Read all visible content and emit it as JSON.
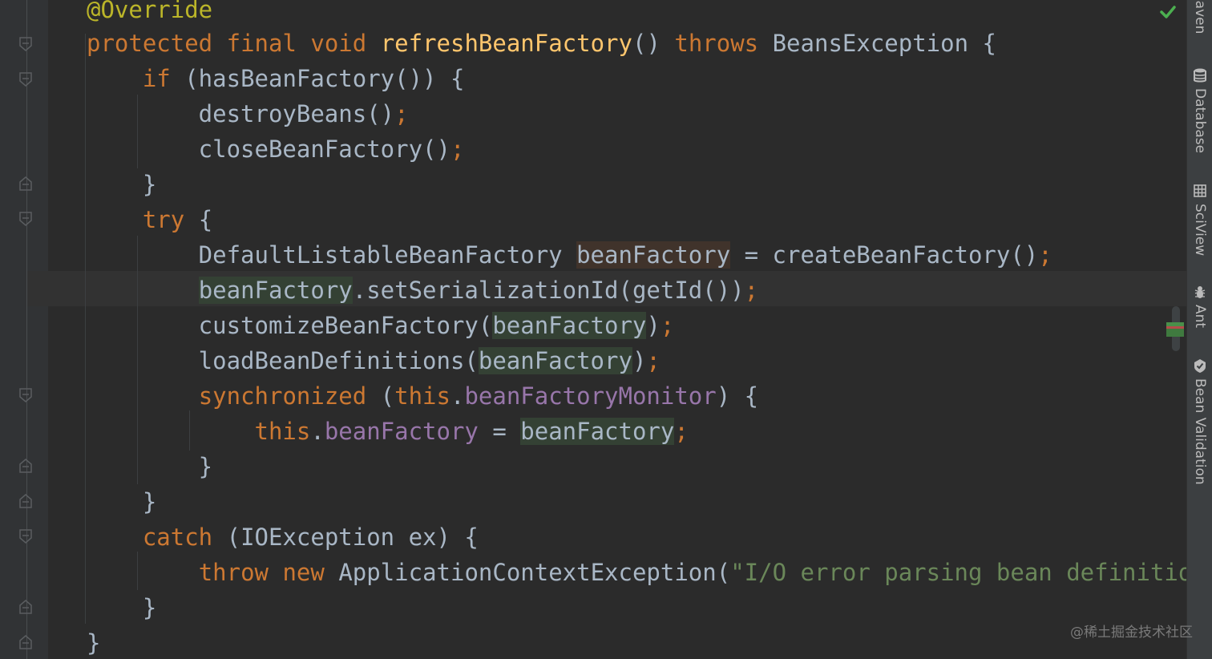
{
  "editor": {
    "lines": [
      {
        "tokens": [
          {
            "t": "@Override",
            "c": "ann"
          }
        ]
      },
      {
        "tokens": [
          {
            "t": "protected",
            "c": "kw"
          },
          {
            "t": " "
          },
          {
            "t": "final",
            "c": "kw"
          },
          {
            "t": " "
          },
          {
            "t": "void",
            "c": "kw"
          },
          {
            "t": " "
          },
          {
            "t": "refreshBeanFactory",
            "c": "fn"
          },
          {
            "t": "() "
          },
          {
            "t": "throws",
            "c": "kw"
          },
          {
            "t": " BeansException {"
          }
        ]
      },
      {
        "tokens": [
          {
            "t": "    "
          },
          {
            "t": "if",
            "c": "kw"
          },
          {
            "t": " (hasBeanFactory()) {"
          }
        ]
      },
      {
        "tokens": [
          {
            "t": "        destroyBeans()"
          },
          {
            "t": ";",
            "c": "semi"
          }
        ]
      },
      {
        "tokens": [
          {
            "t": "        closeBeanFactory()"
          },
          {
            "t": ";",
            "c": "semi"
          }
        ]
      },
      {
        "tokens": [
          {
            "t": "    }"
          }
        ]
      },
      {
        "tokens": [
          {
            "t": "    "
          },
          {
            "t": "try",
            "c": "kw"
          },
          {
            "t": " {"
          }
        ]
      },
      {
        "tokens": [
          {
            "t": "        DefaultListableBeanFactory "
          },
          {
            "t": "beanFactory",
            "c": "hl-red"
          },
          {
            "t": " = createBeanFactory()"
          },
          {
            "t": ";",
            "c": "semi"
          }
        ]
      },
      {
        "tokens": [
          {
            "t": "        "
          },
          {
            "t": "beanFactory",
            "c": "hl-green"
          },
          {
            "t": ".setSerializationId(getId())"
          },
          {
            "t": ";",
            "c": "semi"
          }
        ]
      },
      {
        "tokens": [
          {
            "t": "        customizeBeanFactory("
          },
          {
            "t": "beanFactory",
            "c": "hl-green"
          },
          {
            "t": ")"
          },
          {
            "t": ";",
            "c": "semi"
          }
        ]
      },
      {
        "tokens": [
          {
            "t": "        loadBeanDefinitions("
          },
          {
            "t": "beanFactory",
            "c": "hl-green"
          },
          {
            "t": ")"
          },
          {
            "t": ";",
            "c": "semi"
          }
        ]
      },
      {
        "tokens": [
          {
            "t": "        "
          },
          {
            "t": "synchronized",
            "c": "kw"
          },
          {
            "t": " ("
          },
          {
            "t": "this",
            "c": "kw"
          },
          {
            "t": "."
          },
          {
            "t": "beanFactoryMonitor",
            "c": "fld"
          },
          {
            "t": ") {"
          }
        ]
      },
      {
        "tokens": [
          {
            "t": "            "
          },
          {
            "t": "this",
            "c": "kw"
          },
          {
            "t": "."
          },
          {
            "t": "beanFactory",
            "c": "fld"
          },
          {
            "t": " = "
          },
          {
            "t": "beanFactory",
            "c": "hl-green"
          },
          {
            "t": ";",
            "c": "semi"
          }
        ]
      },
      {
        "tokens": [
          {
            "t": "        }"
          }
        ]
      },
      {
        "tokens": [
          {
            "t": "    }"
          }
        ]
      },
      {
        "tokens": [
          {
            "t": "    "
          },
          {
            "t": "catch",
            "c": "kw"
          },
          {
            "t": " (IOException ex) {"
          }
        ]
      },
      {
        "tokens": [
          {
            "t": "        "
          },
          {
            "t": "throw",
            "c": "kw"
          },
          {
            "t": " "
          },
          {
            "t": "new",
            "c": "kw"
          },
          {
            "t": " ApplicationContextException("
          },
          {
            "t": "\"I/O error parsing bean definition sour",
            "c": "str"
          }
        ]
      },
      {
        "tokens": [
          {
            "t": "    }"
          }
        ]
      },
      {
        "tokens": [
          {
            "t": "}"
          }
        ]
      }
    ]
  },
  "right_toolbar": [
    {
      "label": "Maven",
      "icon": "maven-icon"
    },
    {
      "label": "Database",
      "icon": "database-icon"
    },
    {
      "label": "SciView",
      "icon": "sciview-icon"
    },
    {
      "label": "Ant",
      "icon": "ant-icon"
    },
    {
      "label": "Bean Validation",
      "icon": "bean-validation-icon"
    }
  ],
  "status": {
    "inspection_icon": "check-icon",
    "color": "#4caf50"
  },
  "watermark": "@稀土掘金技术社区"
}
